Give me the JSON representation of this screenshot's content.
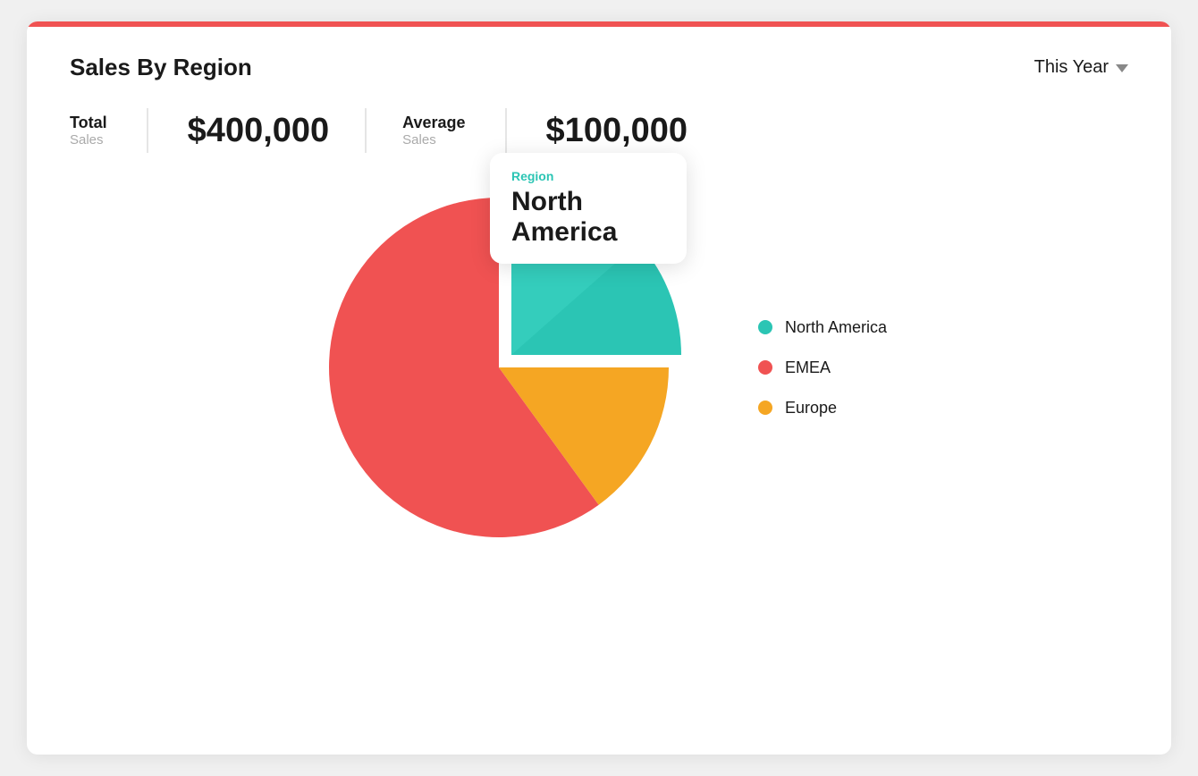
{
  "header": {
    "title": "Sales By Region",
    "year_selector": "This Year"
  },
  "stats": {
    "total_label": "Total",
    "total_sublabel": "Sales",
    "total_value": "$400,000",
    "average_label": "Average",
    "average_sublabel": "Sales",
    "average_value": "$100,000"
  },
  "tooltip": {
    "region_label": "Region",
    "region_value": "North America"
  },
  "legend": {
    "items": [
      {
        "label": "North America",
        "color": "#2bc5b4"
      },
      {
        "label": "EMEA",
        "color": "#f05252"
      },
      {
        "label": "Europe",
        "color": "#f5a623"
      }
    ]
  },
  "chart": {
    "segments": [
      {
        "label": "EMEA",
        "color": "#f05252",
        "percentage": 60
      },
      {
        "label": "North America",
        "color": "#2bc5b4",
        "percentage": 25
      },
      {
        "label": "Europe",
        "color": "#f5a623",
        "percentage": 15
      }
    ]
  }
}
